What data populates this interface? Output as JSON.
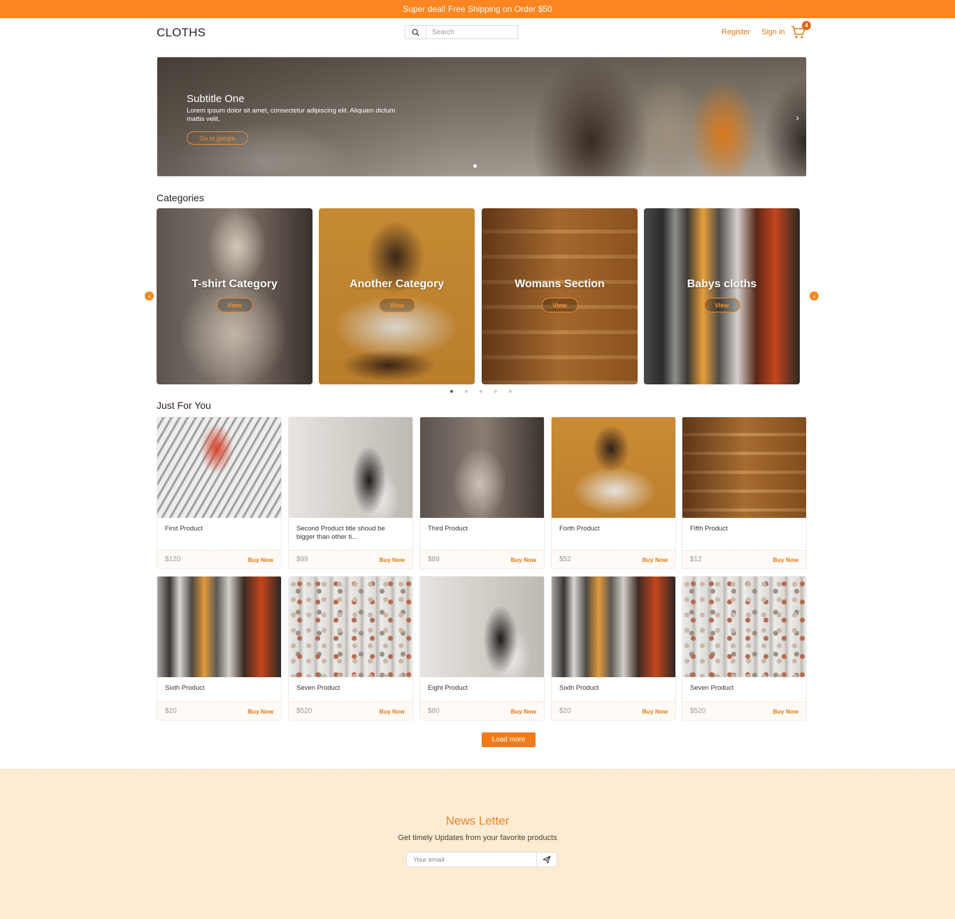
{
  "topbar": {
    "text": "Super deal! Free Shipping on Order $50"
  },
  "header": {
    "logo": "CLOTHS",
    "search_placeholder": "Search",
    "register": "Register",
    "signin": "Sign in",
    "cart_count": "4"
  },
  "hero": {
    "subtitle": "Subtitle One",
    "description": "Lorem ipsum dolor sit amet, consectetur adipiscing elit. Aliquam dictum mattis velit,",
    "cta": "Go to google",
    "arrow": "›"
  },
  "categories": {
    "title": "Categories",
    "items": [
      {
        "title": "T-shirt Category",
        "button": "View"
      },
      {
        "title": "Another Category",
        "button": "View"
      },
      {
        "title": "Womans Section",
        "button": "View"
      },
      {
        "title": "Babys cloths",
        "button": "View"
      }
    ]
  },
  "just_for_you": {
    "title": "Just For You",
    "products": [
      {
        "name": "First Product",
        "price": "$120",
        "buy": "Buy Now"
      },
      {
        "name": "Second Product title shoud be bigger than other ti...",
        "price": "$99",
        "buy": "Buy Now"
      },
      {
        "name": "Third Product",
        "price": "$89",
        "buy": "Buy Now"
      },
      {
        "name": "Forth Product",
        "price": "$52",
        "buy": "Buy Now"
      },
      {
        "name": "Fifth Product",
        "price": "$12",
        "buy": "Buy Now"
      },
      {
        "name": "Sixth Product",
        "price": "$20",
        "buy": "Buy Now"
      },
      {
        "name": "Seven Product",
        "price": "$520",
        "buy": "Buy Now"
      },
      {
        "name": "Eight Product",
        "price": "$80",
        "buy": "Buy Now"
      },
      {
        "name": "Sixth Product",
        "price": "$20",
        "buy": "Buy Now"
      },
      {
        "name": "Seven Product",
        "price": "$520",
        "buy": "Buy Now"
      }
    ],
    "load_more": "Load more"
  },
  "newsletter": {
    "title": "News Letter",
    "subtitle": "Get timely Updates from your favorite products",
    "email_placeholder": "Your email"
  },
  "colors": {
    "accent": "#fb8520",
    "newsletter_bg": "#fdebd3"
  }
}
